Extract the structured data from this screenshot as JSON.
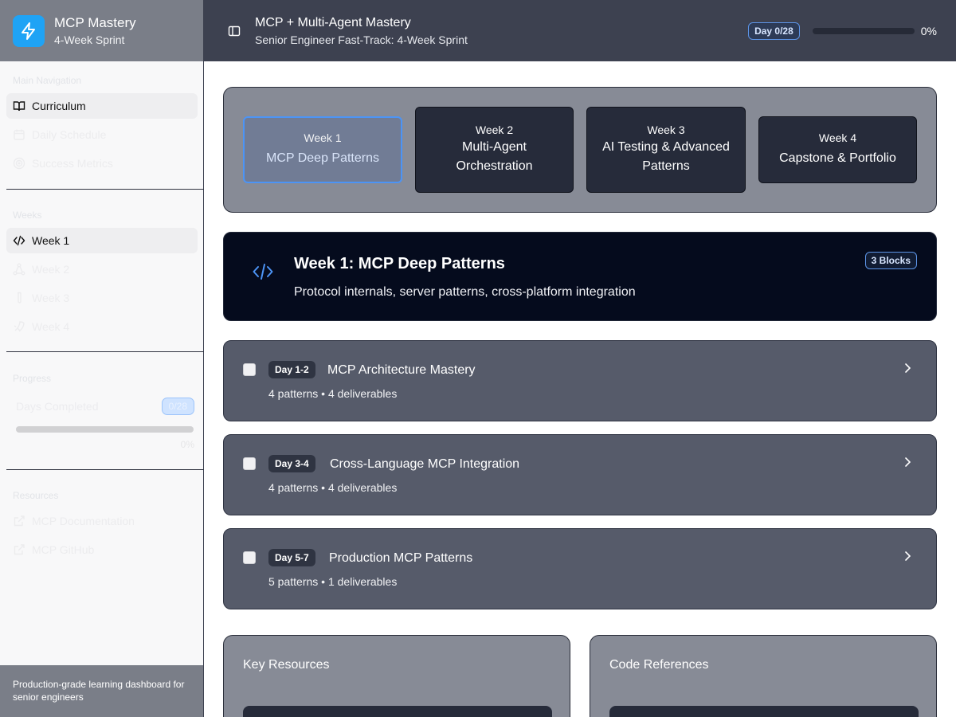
{
  "sidebar": {
    "app_title": "MCP Mastery",
    "app_subtitle": "4-Week Sprint",
    "logo_icon": "lightning-icon",
    "main_nav_label": "Main Navigation",
    "main_nav": [
      {
        "label": "Curriculum",
        "icon": "book-icon",
        "active": true
      },
      {
        "label": "Daily Schedule",
        "icon": "calendar-icon",
        "active": false
      },
      {
        "label": "Success Metrics",
        "icon": "target-icon",
        "active": false
      }
    ],
    "weeks_label": "Weeks",
    "weeks": [
      {
        "label": "Week 1",
        "icon": "code-icon",
        "active": true
      },
      {
        "label": "Week 2",
        "icon": "network-icon",
        "active": false
      },
      {
        "label": "Week 3",
        "icon": "flask-icon",
        "active": false
      },
      {
        "label": "Week 4",
        "icon": "rocket-icon",
        "active": false
      }
    ],
    "progress_label": "Progress",
    "days_completed_label": "Days Completed",
    "days_completed_value": "0/28",
    "progress_pct": "0%",
    "progress_fraction": 0,
    "resources_label": "Resources",
    "resources": [
      {
        "label": "MCP Documentation",
        "icon": "external-link-icon"
      },
      {
        "label": "MCP GitHub",
        "icon": "external-link-icon"
      }
    ],
    "footer": "Production-grade learning dashboard for senior engineers"
  },
  "header": {
    "title": "MCP + Multi-Agent Mastery",
    "subtitle": "Senior Engineer Fast-Track: 4-Week Sprint",
    "day_badge": "Day 0/28",
    "progress_pct": "0%",
    "progress_fraction": 0
  },
  "week_tabs": [
    {
      "week": "Week 1",
      "name": "MCP Deep Patterns",
      "active": true
    },
    {
      "week": "Week 2",
      "name": "Multi-Agent Orchestration",
      "active": false
    },
    {
      "week": "Week 3",
      "name": "AI Testing & Advanced Patterns",
      "active": false
    },
    {
      "week": "Week 4",
      "name": "Capstone & Portfolio",
      "active": false
    }
  ],
  "week_hero": {
    "title": "Week 1: MCP Deep Patterns",
    "subtitle": "Protocol internals, server patterns, cross-platform integration",
    "badge": "3 Blocks",
    "icon": "code-icon"
  },
  "day_blocks": [
    {
      "days": "Day 1-2",
      "title": "MCP Architecture Mastery",
      "meta": "4 patterns • 4 deliverables",
      "checked": false
    },
    {
      "days": "Day 3-4",
      "title": "Cross-Language MCP Integration",
      "meta": "4 patterns • 4 deliverables",
      "checked": false
    },
    {
      "days": "Day 5-7",
      "title": "Production MCP Patterns",
      "meta": "5 patterns • 1 deliverables",
      "checked": false
    }
  ],
  "panels": {
    "key_resources": "Key Resources",
    "code_references": "Code References"
  },
  "colors": {
    "accent": "#4c94f5",
    "header_bg": "#3d4150",
    "logo_bg": "#1fa3f5"
  }
}
